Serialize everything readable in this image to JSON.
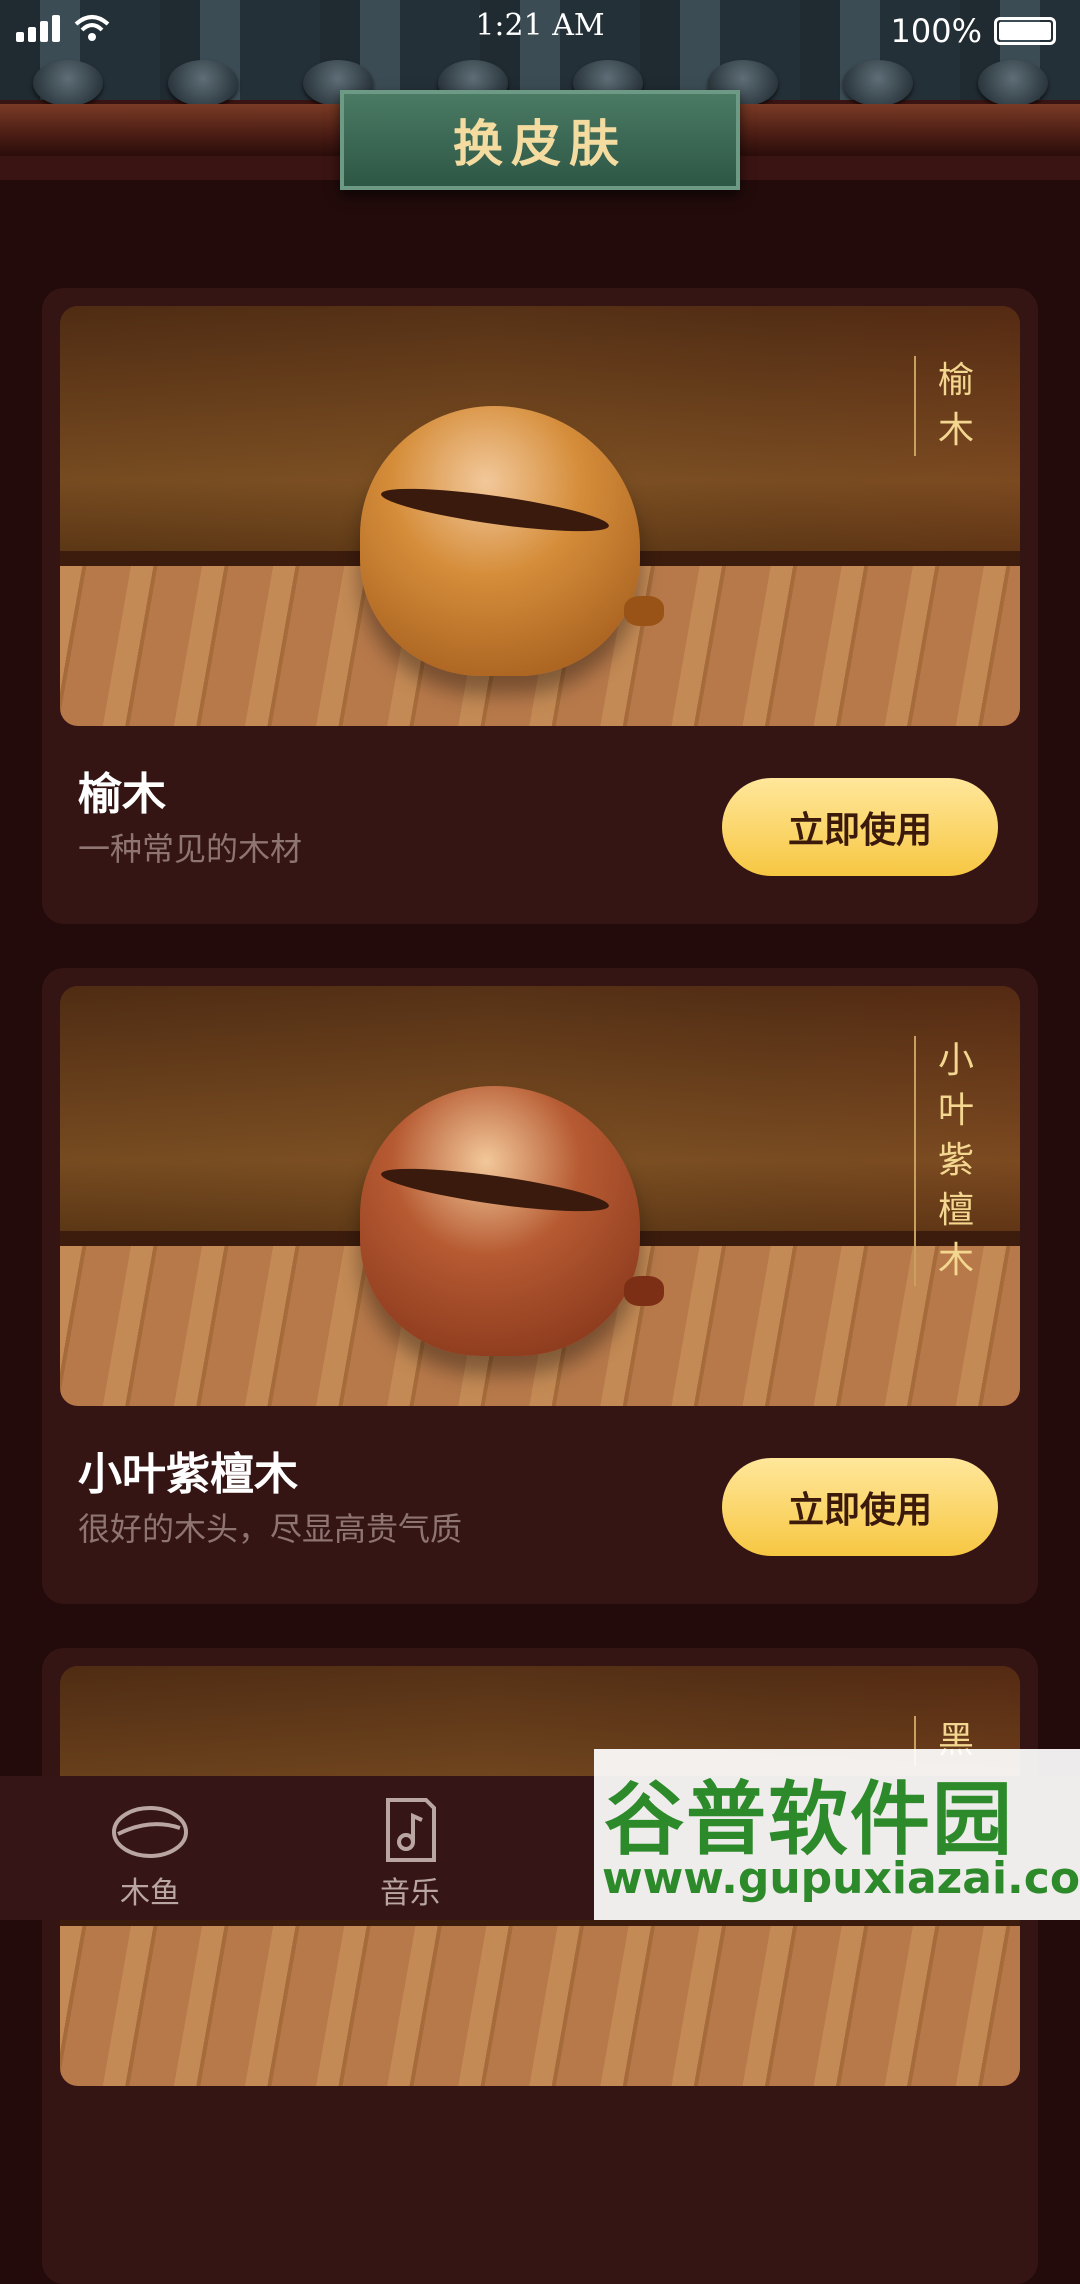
{
  "status_bar": {
    "time": "1:21 AM",
    "battery": "100%"
  },
  "header": {
    "title": "换皮肤"
  },
  "skins": [
    {
      "name": "榆木",
      "desc": "一种常见的木材",
      "vertical_label": "榆木",
      "button": "立即使用",
      "fish_color": "#d58d3a",
      "fish_color_dark": "#9a5317"
    },
    {
      "name": "小叶紫檀木",
      "desc": "很好的木头，尽显高贵气质",
      "vertical_label": "小叶紫檀木",
      "button": "立即使用",
      "fish_color": "#b65a32",
      "fish_color_dark": "#7d2f16"
    },
    {
      "vertical_label": "黑"
    }
  ],
  "tabbar": {
    "items": [
      {
        "label": "木鱼",
        "icon": "wooden-fish-icon"
      },
      {
        "label": "音乐",
        "icon": "music-file-icon"
      }
    ]
  },
  "watermark": {
    "title": "谷普软件园",
    "url": "www.gupuxiazai.com"
  }
}
